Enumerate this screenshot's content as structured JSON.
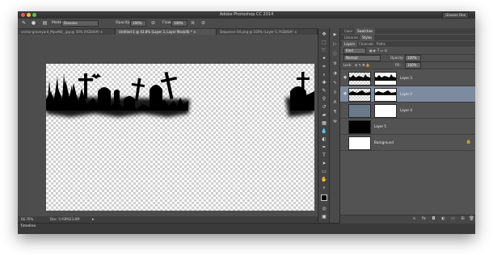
{
  "window": {
    "title": "Adobe Photoshop CC 2014",
    "workspace": "Glasses One",
    "traffic_colors": [
      "#ee5b52",
      "#f3bb3b",
      "#5fc450"
    ]
  },
  "options_bar": {
    "mode_label": "Mode:",
    "mode_value": "Dissolve",
    "opacity_label": "Opacity:",
    "opacity_value": "100%",
    "flow_label": "Flow:",
    "flow_value": "100%"
  },
  "tabs": [
    {
      "label": "vector-graveyard_MyxHt0_.jpg @ 50% (RGB/8#) ×"
    },
    {
      "label": "Untitled-1 @ 43.8% (Layer 3, Layer Mask/8) * ×"
    },
    {
      "label": "Sequence 04.png @ 100% (Layer 0, RGB/8#) ×"
    }
  ],
  "status": {
    "zoom": "66.76%",
    "doc": "Doc: 5.93M/23.8M"
  },
  "timeline": {
    "label": "Timeline"
  },
  "panels": {
    "top_tabs": [
      "Color",
      "Swatches"
    ],
    "lib_tabs": [
      "Libraries",
      "Styles"
    ],
    "layer_tabs": [
      "Layers",
      "Channels",
      "Paths"
    ],
    "kind_label": "Kind",
    "blend_mode": "Normal",
    "opacity_label": "Opacity:",
    "opacity_value": "100%",
    "lock_label": "Lock:",
    "fill_label": "Fill:",
    "fill_value": "100%",
    "layers": [
      {
        "name": "Layer 3",
        "selected": false
      },
      {
        "name": "Layer 2",
        "selected": true
      },
      {
        "name": "Layer 4",
        "selected": false
      },
      {
        "name": "Layer 5",
        "selected": false
      },
      {
        "name": "Background",
        "selected": false
      }
    ]
  },
  "icons": {
    "selected_layer_color": "#7d8ba1",
    "canvas_checker": "#cfcfcf"
  }
}
